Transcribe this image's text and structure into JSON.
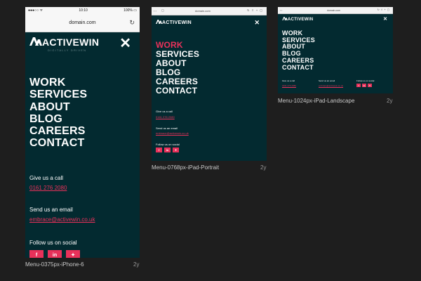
{
  "colors": {
    "canvas": "#1e1e1e",
    "board": "#032a30",
    "accent": "#e8315a"
  },
  "brand": {
    "name": "ACTIVEWIN",
    "tagline": "DIGITALLY DRIVEN"
  },
  "menu": [
    "WORK",
    "SERVICES",
    "ABOUT",
    "BLOG",
    "CAREERS",
    "CONTACT"
  ],
  "contact": {
    "call_label": "Give us a call",
    "phone": "0161 276 2080",
    "email_label": "Send us an email",
    "email": "embrace@activewin.co.uk",
    "social_label": "Follow us on social",
    "social_icons": [
      "facebook-icon",
      "linkedin-icon",
      "twitter-icon"
    ]
  },
  "artboards": {
    "iphone": {
      "name": "Menu-0375px-iPhone-6",
      "age": "2y",
      "status_time": "10:10",
      "battery": "100%",
      "url": "domain.com"
    },
    "ipad_portrait": {
      "name": "Menu-0768px-iPad-Portrait",
      "age": "2y",
      "url": "domain.com"
    },
    "ipad_landscape": {
      "name": "Menu-1024px-iPad-Landscape",
      "age": "2y",
      "url": "domain.com"
    }
  }
}
